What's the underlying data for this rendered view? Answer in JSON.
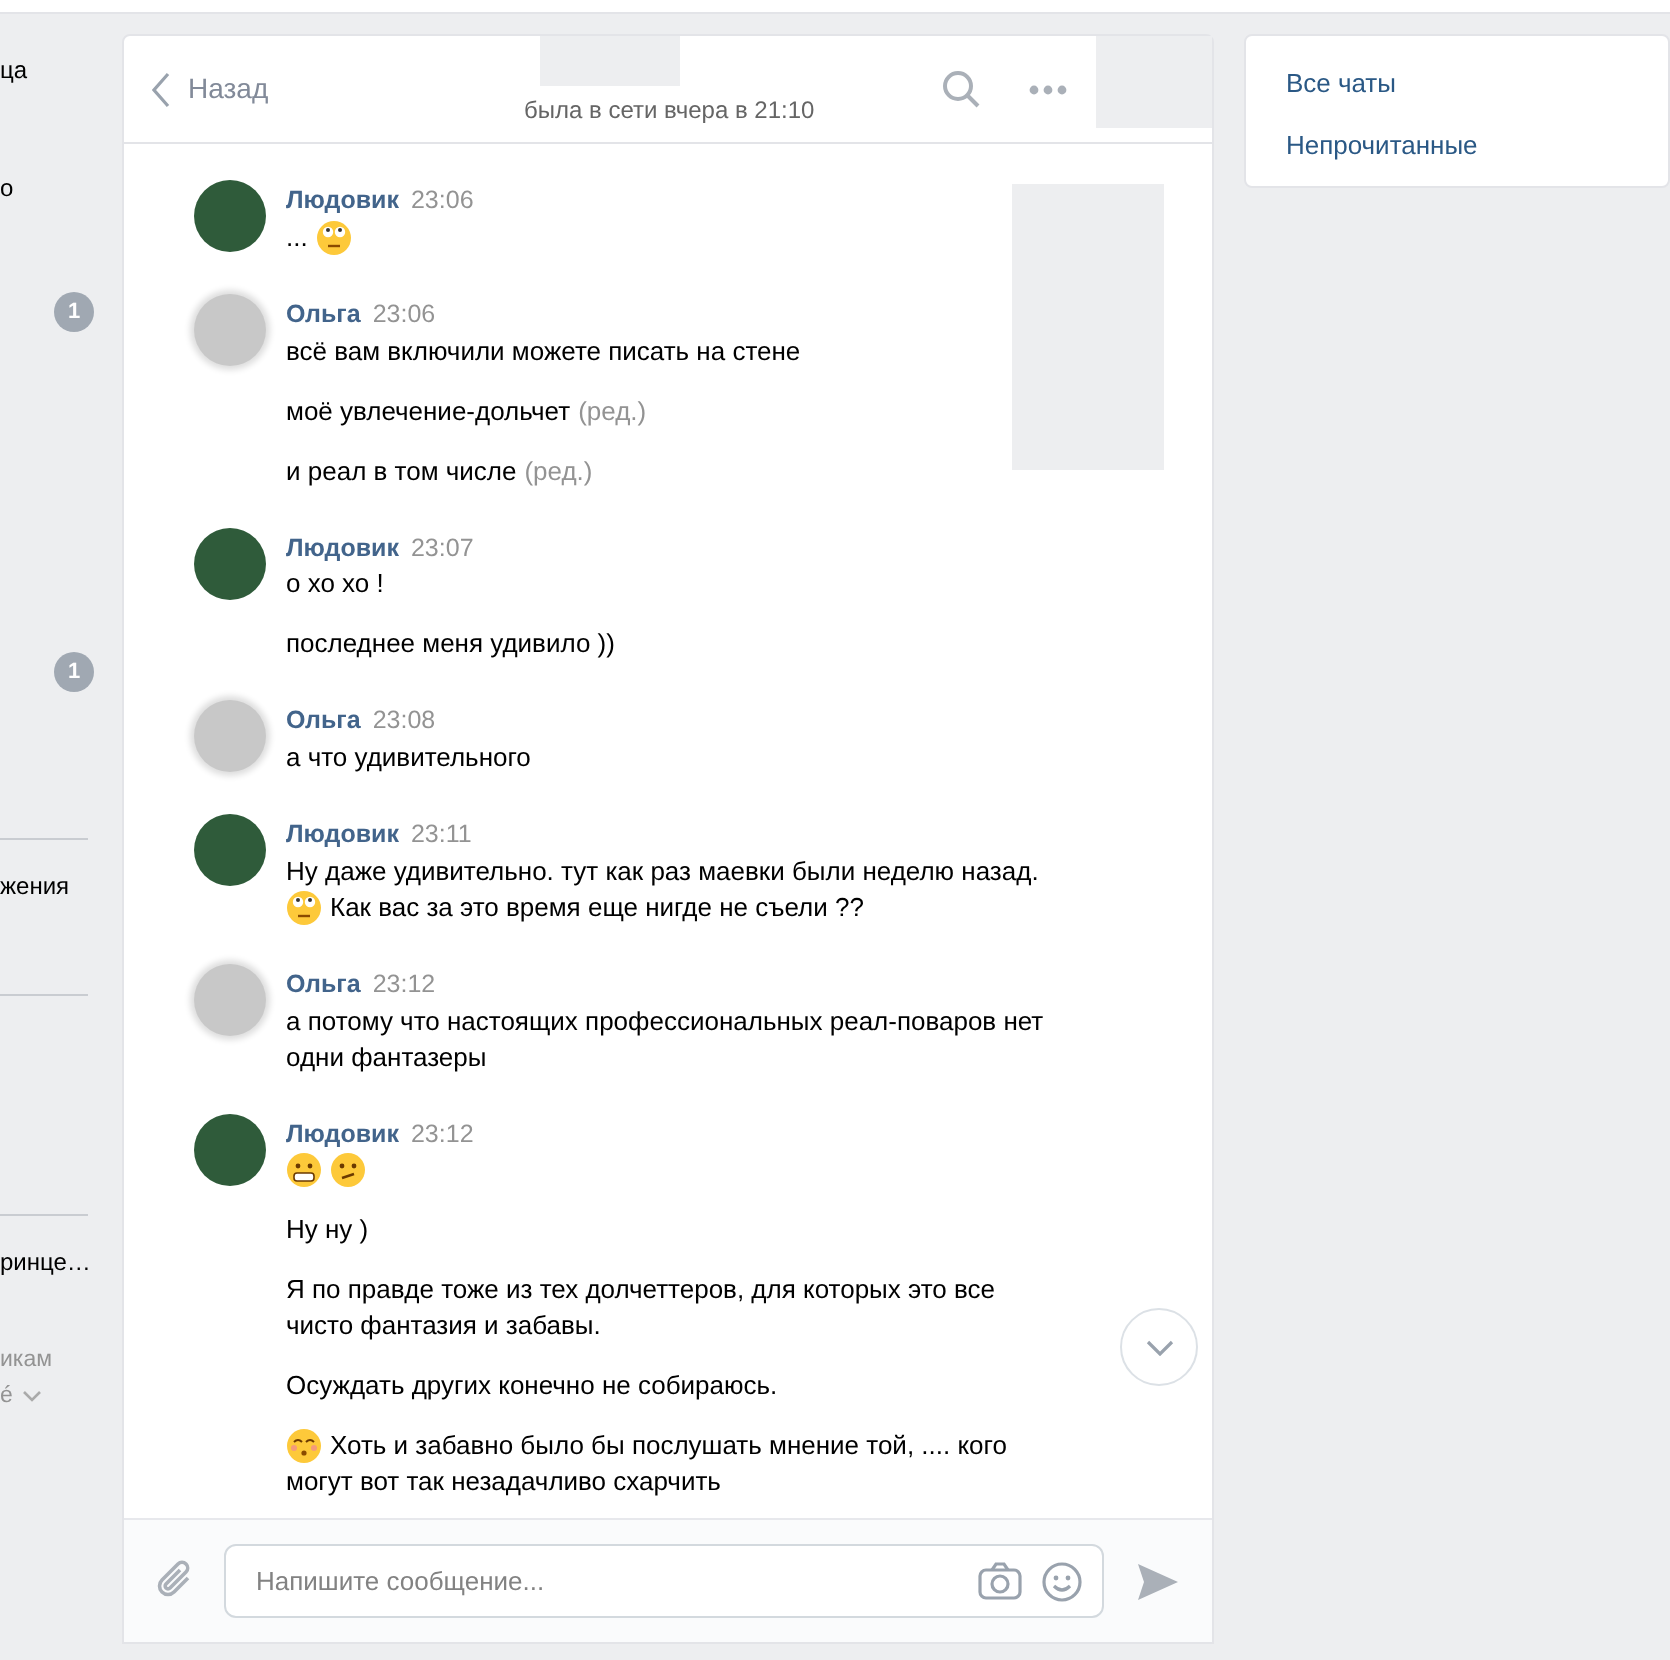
{
  "left_sidebar": {
    "items": [
      {
        "kind": "text",
        "text": "ца"
      },
      {
        "kind": "text",
        "text": "о"
      },
      {
        "kind": "badge",
        "text": "1"
      },
      {
        "kind": "badge",
        "text": "1"
      },
      {
        "kind": "divider"
      },
      {
        "kind": "text",
        "text": "жения"
      },
      {
        "kind": "divider"
      },
      {
        "kind": "divider"
      },
      {
        "kind": "text",
        "text": "ринце…"
      },
      {
        "kind": "muted",
        "text": "икам"
      },
      {
        "kind": "dropdown",
        "text": "é"
      }
    ]
  },
  "chat": {
    "header": {
      "back_label": "Назад",
      "status": "была в сети вчера в 21:10"
    },
    "messages": [
      {
        "author": "Людовик",
        "time": "23:06",
        "kind": "photo",
        "paragraphs": [
          {
            "lines": [
              {
                "text": "...",
                "emoji_after": [
                  {
                    "kind": "eyeroll"
                  }
                ]
              }
            ]
          }
        ]
      },
      {
        "author": "Ольга",
        "time": "23:06",
        "kind": "blurred",
        "paragraphs": [
          {
            "lines": [
              {
                "text": "всё вам включили можете писать на стене"
              }
            ]
          },
          {
            "lines": [
              {
                "text": "моё увлечение-дольчет",
                "edited": "(ред.)"
              }
            ]
          },
          {
            "lines": [
              {
                "text": "и реал в том числе",
                "edited": "(ред.)"
              }
            ]
          }
        ]
      },
      {
        "author": "Людовик",
        "time": "23:07",
        "kind": "photo",
        "paragraphs": [
          {
            "lines": [
              {
                "text": "о хо хо !"
              }
            ]
          },
          {
            "lines": [
              {
                "text": "последнее меня удивило ))"
              }
            ]
          }
        ]
      },
      {
        "author": "Ольга",
        "time": "23:08",
        "kind": "blurred",
        "paragraphs": [
          {
            "lines": [
              {
                "text": "а что удивительного"
              }
            ]
          }
        ]
      },
      {
        "author": "Людовик",
        "time": "23:11",
        "kind": "photo",
        "paragraphs": [
          {
            "lines": [
              {
                "text": "Ну даже удивительно. тут как раз маевки были неделю назад."
              },
              {
                "text": "Как вас за это время еще нигде не съели ??",
                "emoji_before": [
                  {
                    "kind": "eyeroll"
                  }
                ]
              }
            ]
          }
        ]
      },
      {
        "author": "Ольга",
        "time": "23:12",
        "kind": "blurred",
        "paragraphs": [
          {
            "lines": [
              {
                "text": "а потому что настоящих профессиональных реал-поваров нет"
              },
              {
                "text": "одни фантазеры"
              }
            ]
          }
        ]
      },
      {
        "author": "Людовик",
        "time": "23:12",
        "kind": "photo",
        "paragraphs": [
          {
            "lines": [
              {
                "emoji_after": [
                  {
                    "kind": "grimace"
                  },
                  {
                    "kind": "confused"
                  }
                ]
              }
            ]
          },
          {
            "lines": [
              {
                "text": "Ну ну )"
              }
            ]
          },
          {
            "lines": [
              {
                "text": "Я по правде тоже из тех долчеттеров, для которых это все"
              },
              {
                "text": "чисто фантазия и забавы."
              }
            ]
          },
          {
            "lines": [
              {
                "text": "Осуждать других конечно не собираюсь."
              }
            ]
          },
          {
            "lines": [
              {
                "text": "Хоть и забавно было бы послушать мнение той, .... кого",
                "emoji_before": [
                  {
                    "kind": "kiss"
                  }
                ]
              },
              {
                "text": "могут вот так незадачливо схарчить"
              }
            ]
          }
        ]
      }
    ],
    "composer": {
      "placeholder": "Напишите сообщение..."
    }
  },
  "right_panel": {
    "items": [
      {
        "label": "Все чаты"
      },
      {
        "label": "Непрочитанные"
      }
    ]
  }
}
